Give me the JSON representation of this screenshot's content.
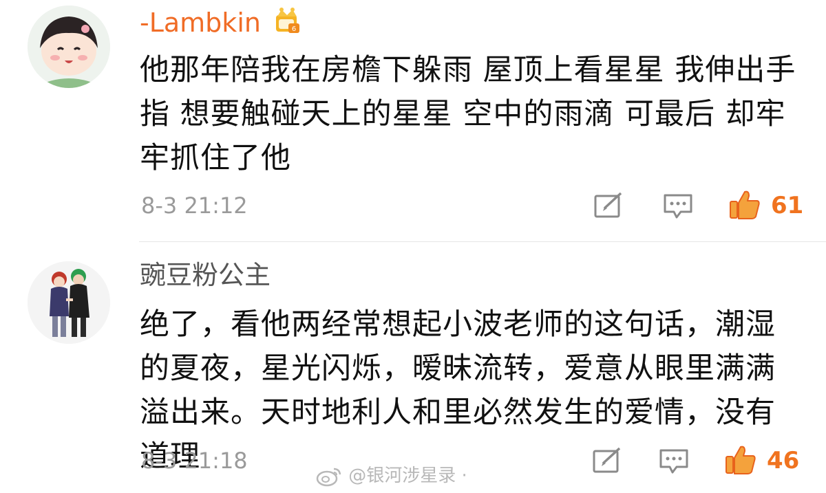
{
  "comments": [
    {
      "username": "-Lambkin",
      "vip_badge_icon": "crown-vip-badge-icon",
      "text": "他那年陪我在房檐下躲雨 屋顶上看星星 我伸出手指 想要触碰天上的星星 空中的雨滴 可最后 却牢牢抓住了他",
      "time": "8-3 21:12",
      "likes": "61"
    },
    {
      "username": "豌豆粉公主",
      "text": "绝了，看他两经常想起小波老师的这句话，潮湿的夏夜，星光闪烁，暧昧流转，爱意从眼里满满溢出来。天时地利人和里必然发生的爱情，没有道理",
      "time": "8-3 21:18",
      "likes": "46"
    }
  ],
  "watermark": "@银河涉星录",
  "colors": {
    "accent": "#f06c26",
    "text": "#111111",
    "muted": "#9a9a9a"
  }
}
